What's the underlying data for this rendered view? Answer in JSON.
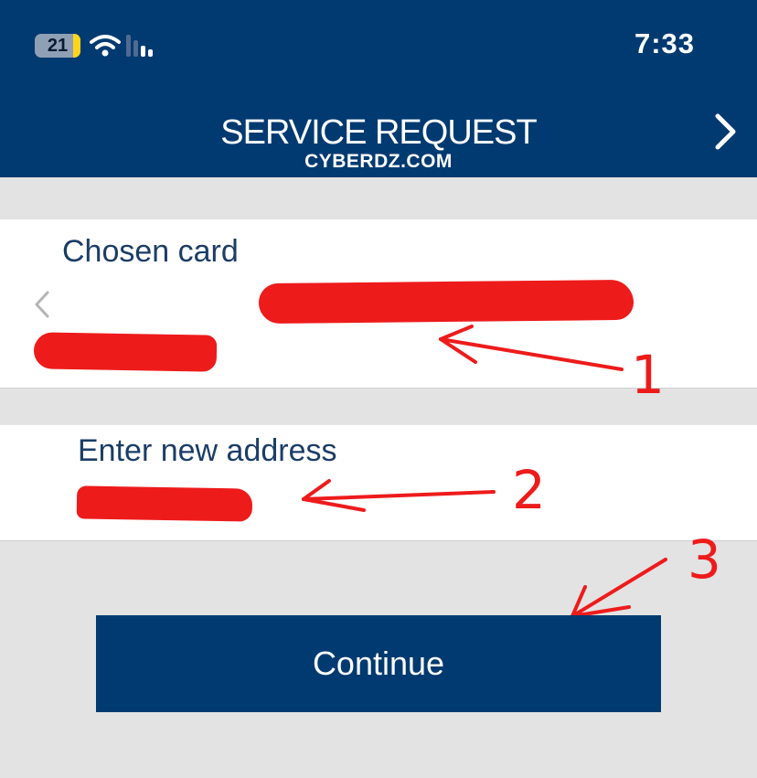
{
  "status_bar": {
    "battery_level": "21",
    "time": "7:33",
    "icons": [
      "battery-icon",
      "wifi-icon",
      "cellular-signal-icon"
    ]
  },
  "header": {
    "title": "SERVICE REQUEST",
    "next_icon": "chevron-right-icon",
    "watermark": "CYBERDZ.COM"
  },
  "card_section": {
    "label": "Chosen card",
    "prev_icon": "chevron-left-icon"
  },
  "address_section": {
    "label": "Enter new address"
  },
  "annotations": {
    "numbers": [
      "1",
      "2",
      "3"
    ]
  },
  "continue_button": {
    "label": "Continue"
  },
  "colors": {
    "brand_blue": "#003a70",
    "background": "#e3e3e3",
    "label_text": "#1b3d66",
    "annotation_red": "#ee1b1b"
  }
}
